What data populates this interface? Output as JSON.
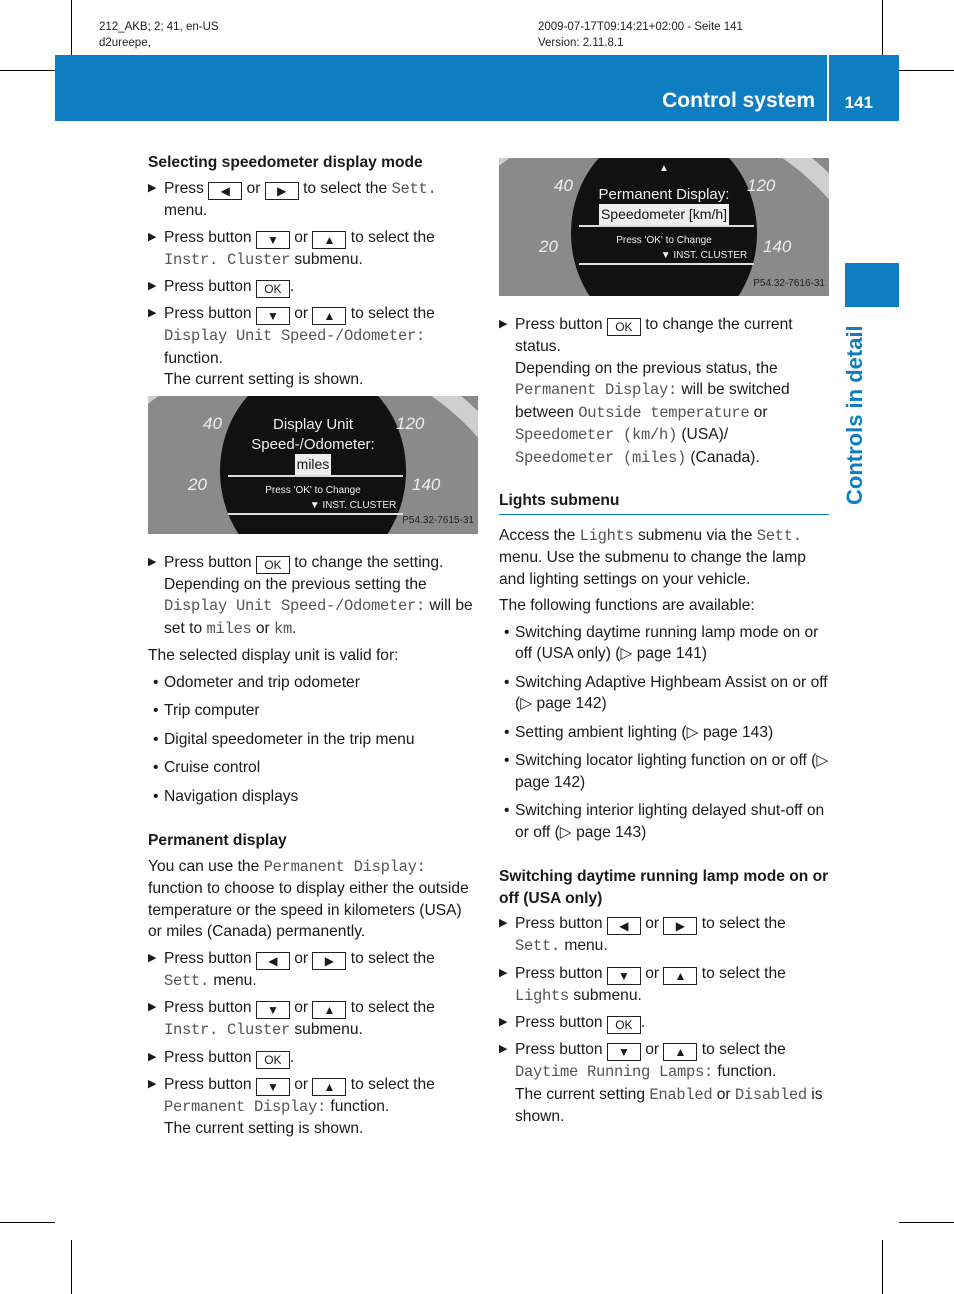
{
  "meta": {
    "left": [
      "212_AKB; 2; 41, en-US",
      "d2ureepe,"
    ],
    "right": [
      "2009-07-17T09:14:21+02:00 - Seite 141",
      "Version: 2.11.8.1"
    ]
  },
  "header": {
    "title": "Control system",
    "page": "141"
  },
  "side_label": "Controls in detail",
  "images": [
    {
      "n20": "20",
      "n40": "40",
      "n120": "120",
      "n140": "140",
      "line1": "Display Unit",
      "line2": "Speed-/Odometer:",
      "selected": "miles",
      "hint": "Press 'OK' to Change",
      "menu": "INST. CLUSTER",
      "code": "P54.32-7615-31"
    },
    {
      "n20": "20",
      "n40": "40",
      "n120": "120",
      "n140": "140",
      "line1": "Permanent Display:",
      "selected": "Speedometer [km/h]",
      "hint": "Press 'OK' to Change",
      "menu": "INST. CLUSTER",
      "code": "P54.32-7616-31"
    }
  ],
  "left": [
    {
      "t": "h",
      "s": [
        "Selecting speedometer display mode"
      ]
    },
    {
      "t": "step",
      "s": [
        "Press ",
        {
          "k": "◀"
        },
        " or ",
        {
          "k": "▶"
        },
        " to select the ",
        {
          "m": "Sett."
        },
        " menu."
      ]
    },
    {
      "t": "step",
      "s": [
        "Press button ",
        {
          "k": "▼"
        },
        " or ",
        {
          "k": "▲"
        },
        " to select the ",
        {
          "m": "Instr. Cluster"
        },
        " submenu."
      ]
    },
    {
      "t": "step",
      "s": [
        "Press button ",
        {
          "k": "OK"
        },
        "."
      ]
    },
    {
      "t": "step",
      "s": [
        "Press button ",
        {
          "k": "▼"
        },
        " or ",
        {
          "k": "▲"
        },
        " to select the ",
        {
          "m": "Display Unit Speed-/Odometer:"
        },
        " function.",
        {
          "br": 1
        },
        "The current setting is shown."
      ]
    },
    {
      "t": "img",
      "i": 0
    },
    {
      "t": "step",
      "s": [
        "Press button ",
        {
          "k": "OK"
        },
        " to change the setting.",
        {
          "br": 1
        },
        "Depending on the previous setting the ",
        {
          "m": "Display Unit Speed-/Odometer:"
        },
        " will be set to ",
        {
          "m": "miles"
        },
        " or ",
        {
          "m": "km"
        },
        "."
      ]
    },
    {
      "t": "p",
      "s": [
        "The selected display unit is valid for:"
      ]
    },
    {
      "t": "bul",
      "s": [
        "Odometer and trip odometer"
      ]
    },
    {
      "t": "bul",
      "s": [
        "Trip computer"
      ]
    },
    {
      "t": "bul",
      "s": [
        "Digital speedometer in the trip menu"
      ]
    },
    {
      "t": "bul",
      "s": [
        "Cruise control"
      ]
    },
    {
      "t": "bul",
      "s": [
        "Navigation displays"
      ]
    },
    {
      "t": "gap"
    },
    {
      "t": "h",
      "s": [
        "Permanent display"
      ]
    },
    {
      "t": "p",
      "s": [
        "You can use the ",
        {
          "m": "Permanent Display:"
        },
        " function to choose to display either the outside temperature or the speed in kilometers (USA) or miles (Canada) permanently."
      ]
    },
    {
      "t": "step",
      "s": [
        "Press button ",
        {
          "k": "◀"
        },
        " or ",
        {
          "k": "▶"
        },
        " to select the ",
        {
          "m": "Sett."
        },
        " menu."
      ]
    },
    {
      "t": "step",
      "s": [
        "Press button ",
        {
          "k": "▼"
        },
        " or ",
        {
          "k": "▲"
        },
        " to select the ",
        {
          "m": "Instr. Cluster"
        },
        " submenu."
      ]
    },
    {
      "t": "step",
      "s": [
        "Press button ",
        {
          "k": "OK"
        },
        "."
      ]
    },
    {
      "t": "step",
      "s": [
        "Press button ",
        {
          "k": "▼"
        },
        " or ",
        {
          "k": "▲"
        },
        " to select the ",
        {
          "m": "Permanent Display:"
        },
        " function.",
        {
          "br": 1
        },
        "The current setting is shown."
      ]
    }
  ],
  "right": [
    {
      "t": "img",
      "i": 1
    },
    {
      "t": "step",
      "s": [
        "Press button ",
        {
          "k": "OK"
        },
        " to change the current status.",
        {
          "br": 1
        },
        "Depending on the previous status, the ",
        {
          "m": "Permanent Display:"
        },
        " will be switched between ",
        {
          "m": "Outside temperature"
        },
        " or ",
        {
          "m": "Speedometer (km/h)"
        },
        " (USA)/ ",
        {
          "m": "Speedometer (miles)"
        },
        " (Canada)."
      ]
    },
    {
      "t": "gap"
    },
    {
      "t": "hr",
      "s": [
        "Lights submenu"
      ]
    },
    {
      "t": "p",
      "s": [
        "Access the ",
        {
          "m": "Lights"
        },
        " submenu via the ",
        {
          "m": "Sett."
        },
        " menu. Use the submenu to change the lamp and lighting settings on your vehicle."
      ]
    },
    {
      "t": "p",
      "s": [
        "The following functions are available:"
      ]
    },
    {
      "t": "bul",
      "s": [
        "Switching daytime running lamp mode on or off (USA only) (▷ page 141)"
      ]
    },
    {
      "t": "bul",
      "s": [
        "Switching Adaptive Highbeam Assist on or off (▷ page 142)"
      ]
    },
    {
      "t": "bul",
      "s": [
        "Setting ambient lighting (▷ page 143)"
      ]
    },
    {
      "t": "bul",
      "s": [
        "Switching locator lighting function on or off (▷ page 142)"
      ]
    },
    {
      "t": "bul",
      "s": [
        "Switching interior lighting delayed shut-off on or off (▷ page 143)"
      ]
    },
    {
      "t": "gap"
    },
    {
      "t": "h",
      "s": [
        "Switching daytime running lamp mode on or off (USA only)"
      ]
    },
    {
      "t": "step",
      "s": [
        "Press button ",
        {
          "k": "◀"
        },
        " or ",
        {
          "k": "▶"
        },
        " to select the ",
        {
          "m": "Sett."
        },
        " menu."
      ]
    },
    {
      "t": "step",
      "s": [
        "Press button ",
        {
          "k": "▼"
        },
        " or ",
        {
          "k": "▲"
        },
        " to select the ",
        {
          "m": "Lights"
        },
        " submenu."
      ]
    },
    {
      "t": "step",
      "s": [
        "Press button ",
        {
          "k": "OK"
        },
        "."
      ]
    },
    {
      "t": "step",
      "s": [
        "Press button ",
        {
          "k": "▼"
        },
        " or ",
        {
          "k": "▲"
        },
        " to select the ",
        {
          "m": "Daytime Running Lamps:"
        },
        " function.",
        {
          "br": 1
        },
        "The current setting ",
        {
          "m": "Enabled"
        },
        " or ",
        {
          "m": "Disabled"
        },
        " is shown."
      ]
    }
  ]
}
